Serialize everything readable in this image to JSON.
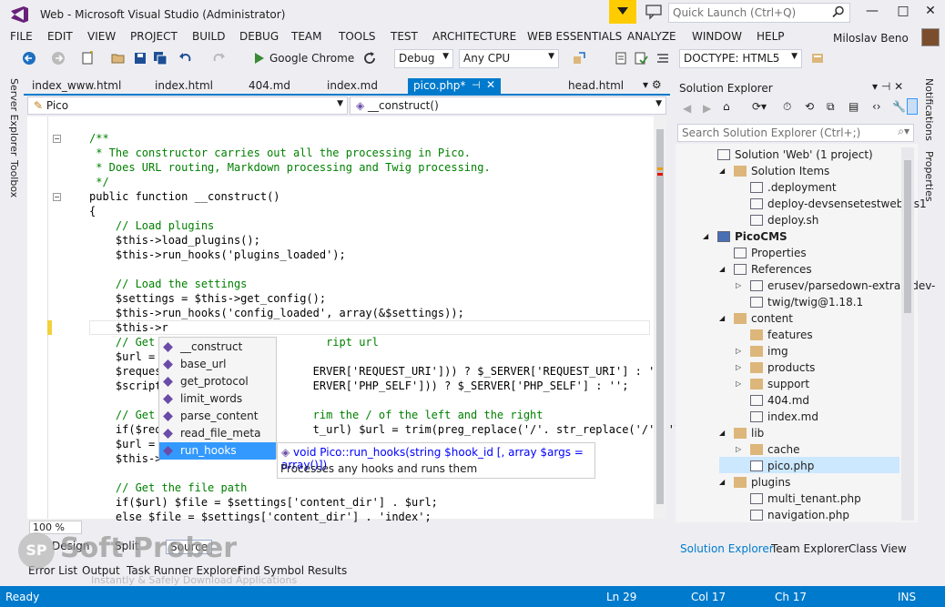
{
  "window": {
    "title": "Web - Microsoft Visual Studio (Administrator)",
    "controls": [
      "—",
      "□",
      "✕"
    ]
  },
  "quick_launch": {
    "placeholder": "Quick Launch (Ctrl+Q)"
  },
  "menu": [
    "FILE",
    "EDIT",
    "VIEW",
    "PROJECT",
    "BUILD",
    "DEBUG",
    "TEAM",
    "TOOLS",
    "TEST",
    "ARCHITECTURE",
    "WEB ESSENTIALS",
    "ANALYZE",
    "WINDOW",
    "HELP"
  ],
  "user": {
    "name": "Miloslav Beno"
  },
  "toolbar": {
    "run_target": "Google Chrome",
    "config": "Debug",
    "platform": "Any CPU",
    "doctype": "DOCTYPE: HTML5"
  },
  "left_tool_tabs": [
    "Server Explorer",
    "Toolbox"
  ],
  "right_tool_tabs": [
    "Notifications",
    "Properties"
  ],
  "doc_tabs": [
    "index_www.html",
    "index.html",
    "404.md",
    "index.md",
    "pico.php*",
    "head.html"
  ],
  "nav": {
    "class": "Pico",
    "member": "__construct()"
  },
  "code_lines": [
    {
      "text": "/**",
      "cls": "cm"
    },
    {
      "text": " * The constructor carries out all the processing in Pico.",
      "cls": "cm"
    },
    {
      "text": " * Does URL routing, Markdown processing and Twig processing.",
      "cls": "cm"
    },
    {
      "text": " */",
      "cls": "cm"
    },
    {
      "text": "public function __construct()",
      "cls": ""
    },
    {
      "text": "{",
      "cls": ""
    },
    {
      "text": "    // Load plugins",
      "cls": "cm"
    },
    {
      "text": "    $this->load_plugins();",
      "cls": ""
    },
    {
      "text": "    $this->run_hooks('plugins_loaded');",
      "cls": ""
    },
    {
      "text": "",
      "cls": ""
    },
    {
      "text": "    // Load the settings",
      "cls": "cm"
    },
    {
      "text": "    $settings = $this->get_config();",
      "cls": ""
    },
    {
      "text": "    $this->run_hooks('config_loaded', array(&$settings));",
      "cls": ""
    },
    {
      "text": "    $this->r",
      "cls": ""
    },
    {
      "text": "    // Get                          ript url",
      "cls": "cm"
    },
    {
      "text": "    $url =",
      "cls": ""
    },
    {
      "text": "    $reques                       ERVER['REQUEST_URI'])) ? $_SERVER['REQUEST_URI'] : '';",
      "cls": ""
    },
    {
      "text": "    $script                       ERVER['PHP_SELF'])) ? $_SERVER['PHP_SELF'] : '';",
      "cls": ""
    },
    {
      "text": "",
      "cls": ""
    },
    {
      "text": "    // Get                        rim the / of the left and the right",
      "cls": "cm"
    },
    {
      "text": "    if($req                       t_url) $url = trim(preg_replace('/'. str_replace('/', '\\/',",
      "cls": ""
    },
    {
      "text": "    $url =",
      "cls": ""
    },
    {
      "text": "    $this->",
      "cls": ""
    },
    {
      "text": "",
      "cls": ""
    },
    {
      "text": "    // Get the file path",
      "cls": "cm"
    },
    {
      "text": "    if($url) $file = $settings['content_dir'] . $url;",
      "cls": ""
    },
    {
      "text": "    else $file = $settings['content_dir'] . 'index';",
      "cls": ""
    }
  ],
  "intellisense": {
    "items": [
      "__construct",
      "base_url",
      "get_protocol",
      "limit_words",
      "parse_content",
      "read_file_meta",
      "run_hooks"
    ],
    "selected": "run_hooks"
  },
  "tooltip": {
    "signature": "void Pico::run_hooks(string $hook_id [, array $args = array()])",
    "description": "Processes any hooks and runs them"
  },
  "zoom": "100 %",
  "view_tabs": [
    "Design",
    "Split",
    "Source"
  ],
  "bottom_tabs": [
    "Error List",
    "Output",
    "Task Runner Explorer",
    "Find Symbol Results"
  ],
  "solution_explorer": {
    "title": "Solution Explorer",
    "search_placeholder": "Search Solution Explorer (Ctrl+;)",
    "tree": [
      {
        "label": "Solution 'Web' (1 project)",
        "indent": 0,
        "icon": "solution"
      },
      {
        "label": "Solution Items",
        "indent": 1,
        "icon": "folder",
        "expanded": true
      },
      {
        "label": ".deployment",
        "indent": 2,
        "icon": "file"
      },
      {
        "label": "deploy-devsensetestweb.ps1",
        "indent": 2,
        "icon": "file"
      },
      {
        "label": "deploy.sh",
        "indent": 2,
        "icon": "file"
      },
      {
        "label": "PicoCMS",
        "indent": 0,
        "icon": "project",
        "expanded": true,
        "bold": true
      },
      {
        "label": "Properties",
        "indent": 1,
        "icon": "wrench"
      },
      {
        "label": "References",
        "indent": 1,
        "icon": "refs",
        "expanded": true
      },
      {
        "label": "erusev/parsedown-extra@dev-",
        "indent": 2,
        "icon": "pkg",
        "collapsed": true
      },
      {
        "label": "twig/twig@1.18.1",
        "indent": 2,
        "icon": "pkg"
      },
      {
        "label": "content",
        "indent": 1,
        "icon": "folder",
        "expanded": true
      },
      {
        "label": "features",
        "indent": 2,
        "icon": "folder"
      },
      {
        "label": "img",
        "indent": 2,
        "icon": "folder",
        "collapsed": true
      },
      {
        "label": "products",
        "indent": 2,
        "icon": "folder",
        "collapsed": true
      },
      {
        "label": "support",
        "indent": 2,
        "icon": "folder",
        "collapsed": true
      },
      {
        "label": "404.md",
        "indent": 2,
        "icon": "file"
      },
      {
        "label": "index.md",
        "indent": 2,
        "icon": "file"
      },
      {
        "label": "lib",
        "indent": 1,
        "icon": "folder",
        "expanded": true
      },
      {
        "label": "cache",
        "indent": 2,
        "icon": "folder",
        "collapsed": true
      },
      {
        "label": "pico.php",
        "indent": 2,
        "icon": "php",
        "selected": true
      },
      {
        "label": "plugins",
        "indent": 1,
        "icon": "folder",
        "expanded": true
      },
      {
        "label": "multi_tenant.php",
        "indent": 2,
        "icon": "file"
      },
      {
        "label": "navigation.php",
        "indent": 2,
        "icon": "file"
      }
    ],
    "tabs": [
      "Solution Explorer",
      "Team Explorer",
      "Class View"
    ]
  },
  "status": {
    "state": "Ready",
    "line": "Ln 29",
    "col": "Col 17",
    "ch": "Ch 17",
    "mode": "INS"
  },
  "watermark": {
    "brand": "Soft Prober",
    "tagline": "Instantly & Safely Download Applications",
    "logo_letters": "SP"
  }
}
